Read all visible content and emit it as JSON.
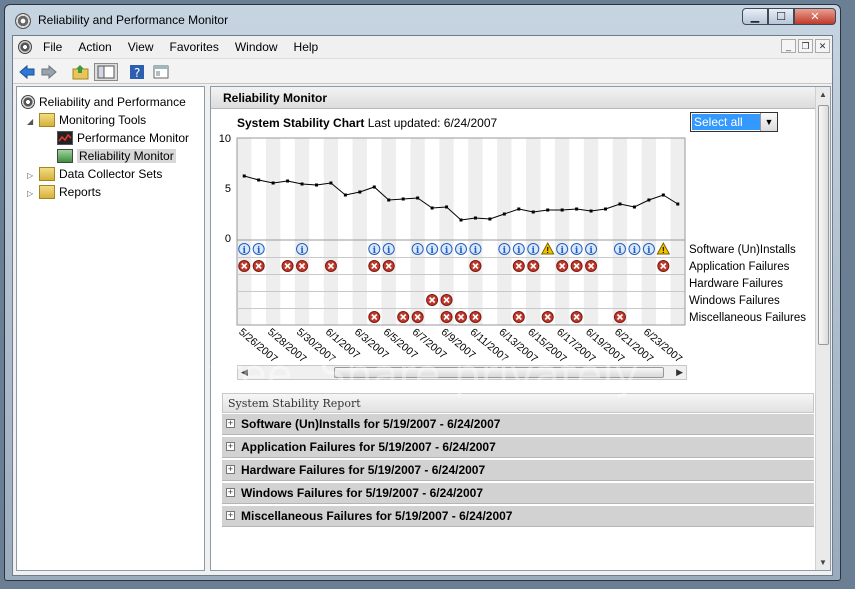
{
  "window": {
    "title": "Reliability and Performance Monitor"
  },
  "menu": [
    "File",
    "Action",
    "View",
    "Favorites",
    "Window",
    "Help"
  ],
  "toolbar": [
    "back-icon",
    "forward-icon",
    "up-folder-icon",
    "show-hide-tree-icon",
    "help-icon",
    "properties-icon"
  ],
  "tree": {
    "root": "Reliability and Performance",
    "monitoring": "Monitoring Tools",
    "perf": "Performance Monitor",
    "rel": "Reliability Monitor",
    "dcs": "Data Collector Sets",
    "reports": "Reports"
  },
  "main": {
    "header": "Reliability Monitor",
    "chart_title": "System Stability Chart",
    "last_updated": "Last updated: 6/24/2007",
    "select": "Select all",
    "report_header": "System Stability Report",
    "report_rows": [
      "Software (Un)Installs for 5/19/2007 - 6/24/2007",
      "Application Failures for 5/19/2007 - 6/24/2007",
      "Hardware Failures for 5/19/2007 - 6/24/2007",
      "Windows Failures for 5/19/2007 - 6/24/2007",
      "Miscellaneous Failures for 5/19/2007 - 6/24/2007"
    ]
  },
  "watermark": "Join free. Share privately.",
  "chart_data": {
    "type": "line",
    "ylim": [
      0,
      10
    ],
    "yticks": [
      "10",
      "5",
      "0"
    ],
    "dates": [
      "5/26/2007",
      "5/28/2007",
      "5/30/2007",
      "6/1/2007",
      "6/3/2007",
      "6/5/2007",
      "6/7/2007",
      "6/9/2007",
      "6/11/2007",
      "6/13/2007",
      "6/15/2007",
      "6/17/2007",
      "6/19/2007",
      "6/21/2007",
      "6/23/2007"
    ],
    "stability_index": [
      6.2,
      5.8,
      5.5,
      5.7,
      5.4,
      5.3,
      5.5,
      4.3,
      4.6,
      5.1,
      3.8,
      3.9,
      4.0,
      3.0,
      3.1,
      1.8,
      2.0,
      1.9,
      2.4,
      2.9,
      2.6,
      2.8,
      2.8,
      2.9,
      2.7,
      2.9,
      3.4,
      3.1,
      3.8,
      4.3,
      3.4
    ],
    "rows": [
      "Software (Un)Installs",
      "Application Failures",
      "Hardware Failures",
      "Windows Failures",
      "Miscellaneous Failures"
    ],
    "events": {
      "software_info": [
        0,
        1,
        4,
        9,
        10,
        12,
        13,
        14,
        15,
        16,
        18,
        19,
        20,
        22,
        23,
        24,
        26,
        27,
        28
      ],
      "software_warning": [
        21,
        29
      ],
      "app_failures": [
        0,
        1,
        3,
        4,
        6,
        9,
        10,
        16,
        19,
        20,
        22,
        23,
        24,
        29
      ],
      "windows_failures": [
        13,
        14
      ],
      "misc_failures": [
        9,
        11,
        12,
        14,
        15,
        16,
        19,
        21,
        23,
        26
      ]
    }
  },
  "colors": {
    "selection": "#3399ff",
    "line": "#000000",
    "error": "#c0392b",
    "info": "#1f5fbf",
    "warning": "#f2c200"
  }
}
